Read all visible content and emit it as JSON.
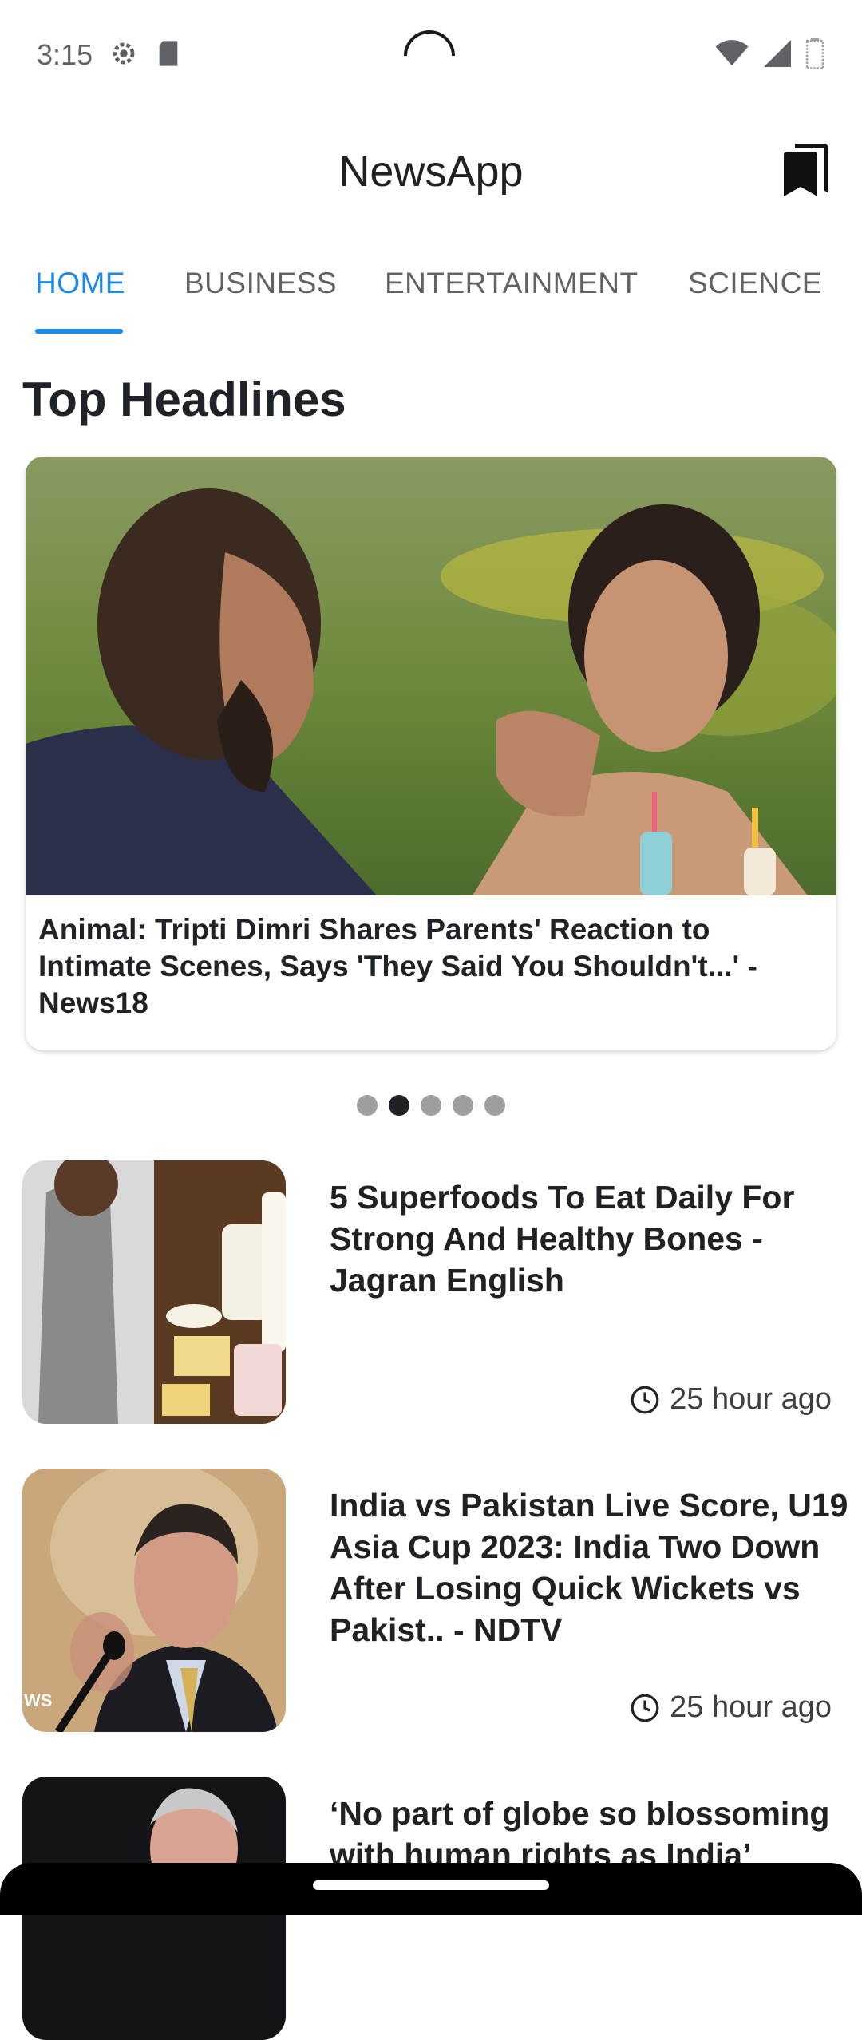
{
  "status_bar": {
    "time": "3:15",
    "left_icons": [
      "settings-gear-icon",
      "sd-card-icon"
    ],
    "right_icons": [
      "wifi-icon",
      "cellular-signal-icon",
      "battery-icon"
    ]
  },
  "app_bar": {
    "title": "NewsApp",
    "bookmark_icon": "bookmarks-icon"
  },
  "tabs": [
    {
      "label": "HOME",
      "active": true
    },
    {
      "label": "BUSINESS",
      "active": false
    },
    {
      "label": "ENTERTAINMENT",
      "active": false
    },
    {
      "label": "SCIENCE",
      "active": false
    }
  ],
  "section_title": "Top Headlines",
  "carousel": {
    "headline": "Animal: Tripti Dimri Shares Parents' Reaction to Intimate Scenes, Says 'They Said You Shouldn't...' - News18",
    "page_count": 5,
    "active_index": 1
  },
  "news": [
    {
      "title": "5 Superfoods To Eat Daily For Strong And Healthy Bones - Jagran English",
      "time": "25 hour ago"
    },
    {
      "title": "India vs Pakistan Live Score, U19 Asia Cup 2023: India Two Down After Losing Quick Wickets vs Pakist.. - NDTV",
      "time": "25 hour ago",
      "thumb_text": "WS"
    },
    {
      "title": "‘No part of globe so blossoming with human rights as India’",
      "time": ""
    }
  ],
  "colors": {
    "accent": "#1e88e5",
    "text_primary": "#202124",
    "text_secondary": "#5f6368"
  }
}
